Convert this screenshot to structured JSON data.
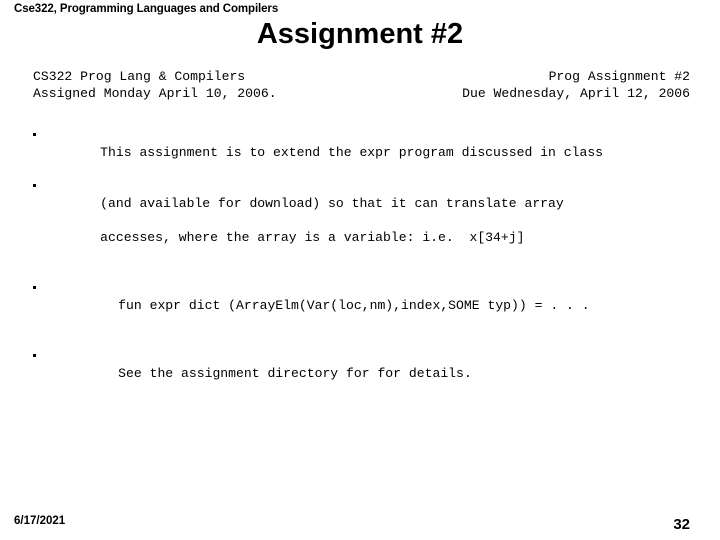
{
  "slide": {
    "header": "Cse322, Programming Languages and Compilers",
    "title": "Assignment #2",
    "info": {
      "row1": {
        "left": "CS322 Prog Lang & Compilers",
        "right": "Prog Assignment #2"
      },
      "row2": {
        "left": "Assigned Monday April 10, 2006.",
        "right": "Due Wednesday, April 12, 2006"
      }
    },
    "bullets": [
      {
        "marker": "square-bullet",
        "indent": "normal",
        "lines": [
          "This assignment is to extend the expr program discussed in class"
        ]
      },
      {
        "marker": "square-bullet",
        "indent": "normal",
        "lines": [
          "(and available for download) so that it can translate array",
          "accesses, where the array is a variable: i.e.  x[34+j]"
        ]
      },
      {
        "marker": "square-bullet",
        "indent": "deep",
        "lines": [
          "fun expr dict (ArrayElm(Var(loc,nm),index,SOME typ)) = . . ."
        ]
      },
      {
        "marker": "square-bullet",
        "indent": "deep",
        "lines": [
          "See the assignment directory for for details."
        ]
      }
    ],
    "footer": {
      "date": "6/17/2021",
      "page_number": "32"
    }
  }
}
